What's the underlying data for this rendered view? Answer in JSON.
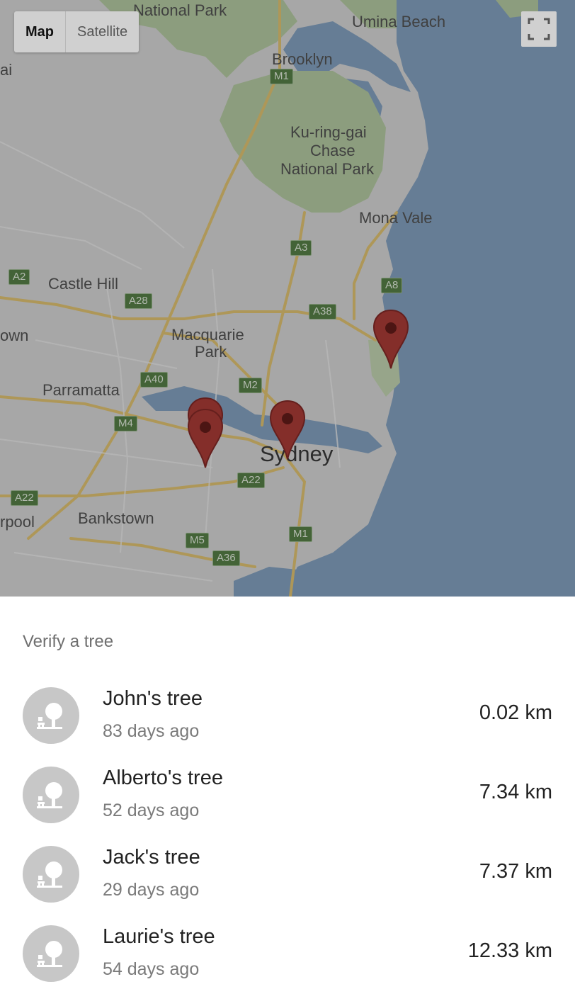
{
  "map": {
    "type_buttons": [
      "Map",
      "Satellite"
    ],
    "place_labels": {
      "national_park_top": "National Park",
      "umina_beach": "Umina Beach",
      "brooklyn": "Brooklyn",
      "kuringgai_1": "Ku-ring-gai",
      "kuringgai_2": "Chase",
      "kuringgai_3": "National Park",
      "mona_vale": "Mona Vale",
      "castle_hill": "Castle Hill",
      "macquarie_1": "Macquarie",
      "macquarie_2": "Park",
      "parramatta": "Parramatta",
      "sydney": "Sydney",
      "bankstown": "Bankstown",
      "cut_left_1": "ai",
      "cut_left_2": "own",
      "cut_left_3": "rpool"
    },
    "road_shields": {
      "m1_top": "M1",
      "a3": "A3",
      "a2": "A2",
      "a8": "A8",
      "a28": "A28",
      "a38": "A38",
      "a40": "A40",
      "m2": "M2",
      "m4": "M4",
      "a22_left": "A22",
      "a22_mid": "A22",
      "m1_bottom": "M1",
      "m5": "M5",
      "a36": "A36"
    },
    "fullscreen_icon": "fullscreen-icon",
    "marker_icon": "map-pin-icon",
    "colors": {
      "water": "#7f9fc0",
      "land": "#d9d9d9",
      "park": "#b3cba0",
      "road": "#e2c36b",
      "marker": "#a8312b"
    }
  },
  "panel": {
    "title": "Verify a tree",
    "avatar_icon": "tree-icon",
    "trees": [
      {
        "name": "John's tree",
        "age": "83 days ago",
        "distance": "0.02 km"
      },
      {
        "name": "Alberto's tree",
        "age": "52 days ago",
        "distance": "7.34 km"
      },
      {
        "name": "Jack's tree",
        "age": "29 days ago",
        "distance": "7.37 km"
      },
      {
        "name": "Laurie's tree",
        "age": "54 days ago",
        "distance": "12.33 km"
      }
    ]
  }
}
